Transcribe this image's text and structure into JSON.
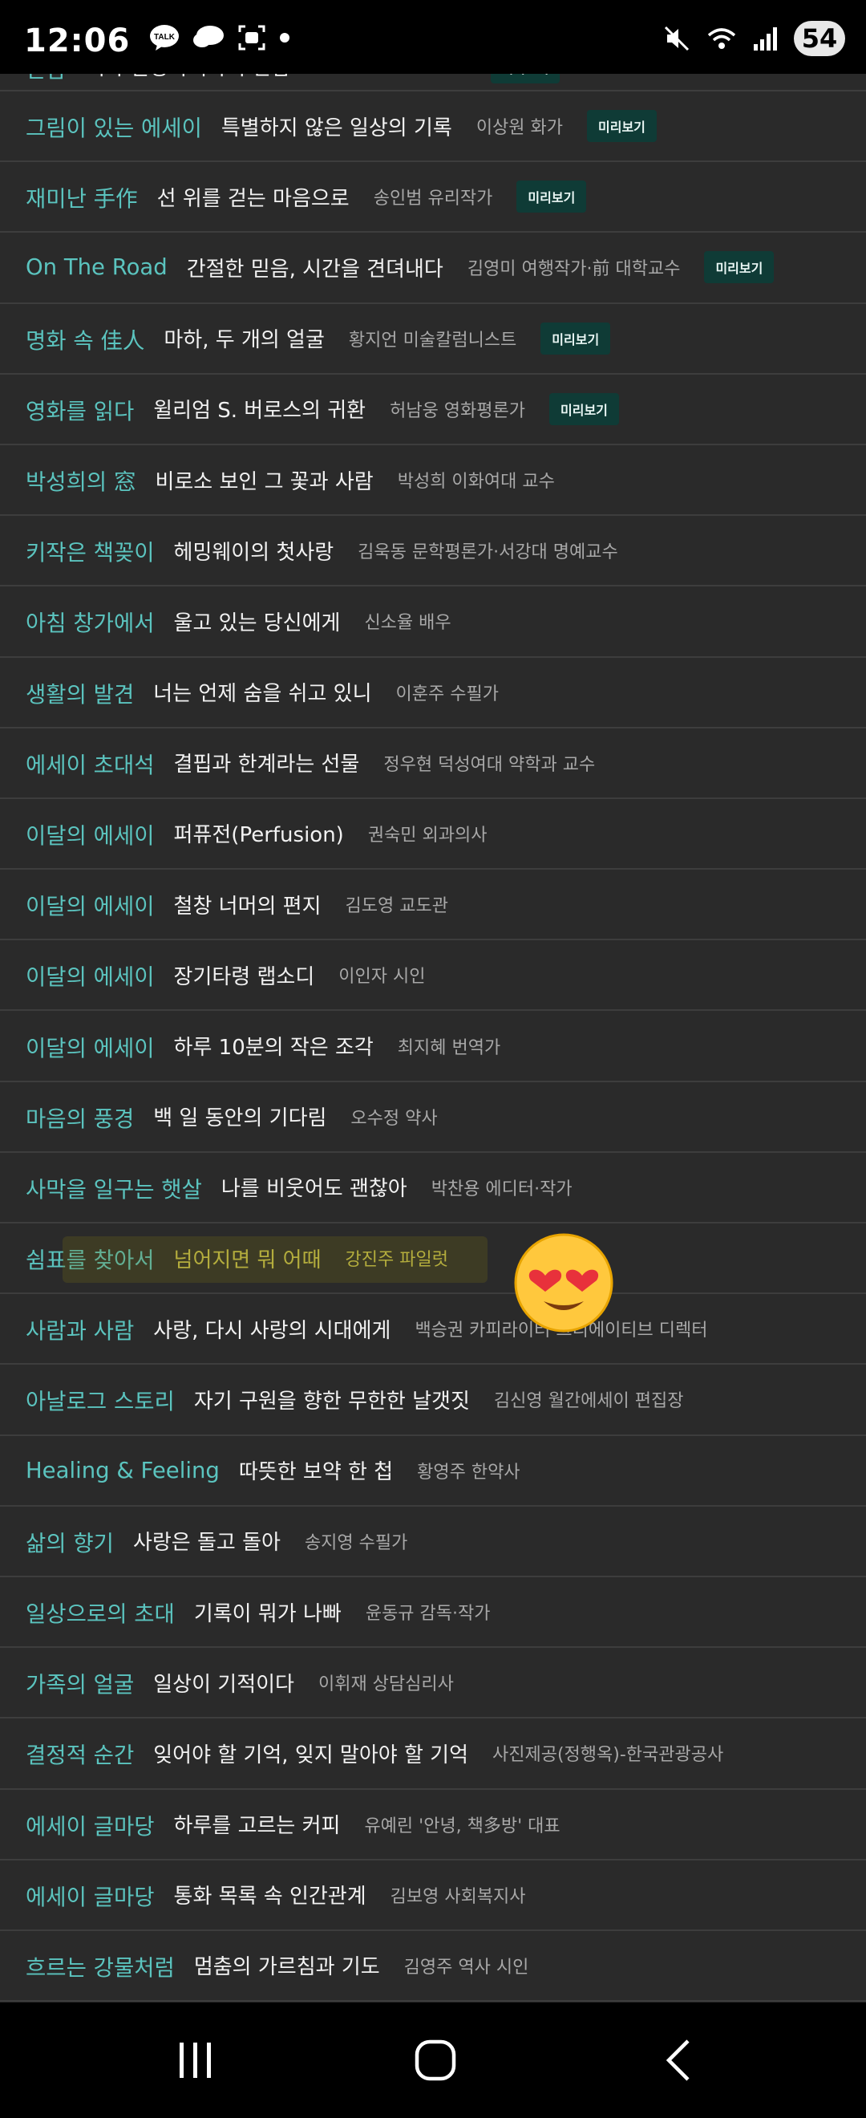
{
  "status": {
    "time": "12:06",
    "battery": "54"
  },
  "rows": [
    {
      "cat": "만남",
      "title": "백자 달항아리와의 만남",
      "author": "전인건 간송미술관장",
      "preview": "미리보기"
    },
    {
      "cat": "그림이 있는 에세이",
      "title": "특별하지 않은 일상의 기록",
      "author": "이상원 화가",
      "preview": "미리보기"
    },
    {
      "cat": "재미난 手作",
      "title": "선 위를 걷는 마음으로",
      "author": "송인범 유리작가",
      "preview": "미리보기"
    },
    {
      "cat": "On The Road",
      "title": "간절한 믿음, 시간을 견뎌내다",
      "author": "김영미 여행작가·前 대학교수",
      "preview": "미리보기"
    },
    {
      "cat": "명화 속 佳人",
      "title": "마하, 두 개의 얼굴",
      "author": "황지언 미술칼럼니스트",
      "preview": "미리보기"
    },
    {
      "cat": "영화를 읽다",
      "title": "윌리엄 S. 버로스의 귀환",
      "author": "허남웅 영화평론가",
      "preview": "미리보기"
    },
    {
      "cat": "박성희의 窓",
      "title": "비로소 보인 그 꽃과 사람",
      "author": "박성희 이화여대 교수",
      "preview": ""
    },
    {
      "cat": "키작은 책꽂이",
      "title": "헤밍웨이의 첫사랑",
      "author": "김욱동 문학평론가·서강대 명예교수",
      "preview": ""
    },
    {
      "cat": "아침 창가에서",
      "title": "울고 있는 당신에게",
      "author": "신소율 배우",
      "preview": ""
    },
    {
      "cat": "생활의 발견",
      "title": "너는 언제 숨을 쉬고 있니",
      "author": "이훈주 수필가",
      "preview": ""
    },
    {
      "cat": "에세이 초대석",
      "title": "결핍과 한계라는 선물",
      "author": "정우현 덕성여대 약학과 교수",
      "preview": ""
    },
    {
      "cat": "이달의 에세이",
      "title": "퍼퓨전(Perfusion)",
      "author": "권숙민 외과의사",
      "preview": ""
    },
    {
      "cat": "이달의 에세이",
      "title": "철창 너머의 편지",
      "author": "김도영 교도관",
      "preview": ""
    },
    {
      "cat": "이달의 에세이",
      "title": "장기타령 랩소디",
      "author": "이인자 시인",
      "preview": ""
    },
    {
      "cat": "이달의 에세이",
      "title": "하루 10분의 작은 조각",
      "author": "최지혜 번역가",
      "preview": ""
    },
    {
      "cat": "마음의 풍경",
      "title": "백 일 동안의 기다림",
      "author": "오수정 약사",
      "preview": ""
    },
    {
      "cat": "사막을 일구는 햇살",
      "title": "나를 비웃어도 괜찮아",
      "author": "박찬용 에디터·작가",
      "preview": ""
    },
    {
      "cat": "쉼표를 찾아서",
      "title": "넘어지면 뭐 어때",
      "author": "강진주 파일럿",
      "preview": ""
    },
    {
      "cat": "사람과 사람",
      "title": "사랑, 다시 사랑의 시대에게",
      "author": "백승권 카피라이터·크리에이티브 디렉터",
      "preview": ""
    },
    {
      "cat": "아날로그 스토리",
      "title": "자기 구원을 향한 무한한 날갯짓",
      "author": "김신영 월간에세이 편집장",
      "preview": ""
    },
    {
      "cat": "Healing & Feeling",
      "title": "따뜻한 보약 한 첩",
      "author": "황영주 한약사",
      "preview": ""
    },
    {
      "cat": "삶의 향기",
      "title": "사랑은 돌고 돌아",
      "author": "송지영 수필가",
      "preview": ""
    },
    {
      "cat": "일상으로의 초대",
      "title": "기록이 뭐가 나빠",
      "author": "윤동규 감독·작가",
      "preview": ""
    },
    {
      "cat": "가족의 얼굴",
      "title": "일상이 기적이다",
      "author": "이휘재 상담심리사",
      "preview": ""
    },
    {
      "cat": "결정적 순간",
      "title": "잊어야 할 기억, 잊지 말아야 할 기억",
      "author": "사진제공(정행옥)-한국관광공사",
      "preview": ""
    },
    {
      "cat": "에세이 글마당",
      "title": "하루를 고르는 커피",
      "author": "유예린 '안녕, 책多방' 대표",
      "preview": ""
    },
    {
      "cat": "에세이 글마당",
      "title": "통화 목록 속 인간관계",
      "author": "김보영 사회복지사",
      "preview": ""
    },
    {
      "cat": "흐르는 강물처럼",
      "title": "멈춤의 가르침과 기도",
      "author": "김영주 역사 시인",
      "preview": ""
    }
  ]
}
